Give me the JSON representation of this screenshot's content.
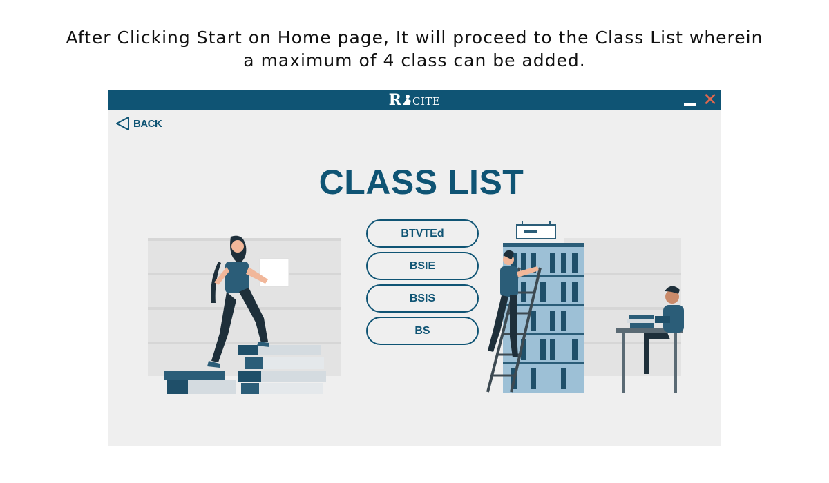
{
  "caption": {
    "line1": "After Clicking Start on Home page, It will proceed to the Class List wherein",
    "line2": "a maximum of 4 class can be added."
  },
  "window": {
    "logo_r": "R",
    "logo_rest": "CITE",
    "close_glyph": "✕",
    "title_bar_color": "#0f5474",
    "close_color": "#e0684e"
  },
  "back": {
    "label": "BACK",
    "icon": "triangle-left-icon"
  },
  "heading": "CLASS LIST",
  "classes": [
    {
      "label": "BTVTEd"
    },
    {
      "label": "BSIE"
    },
    {
      "label": "BSIS"
    },
    {
      "label": "BS"
    }
  ],
  "colors": {
    "accent": "#0f5474",
    "background": "#efefef"
  }
}
